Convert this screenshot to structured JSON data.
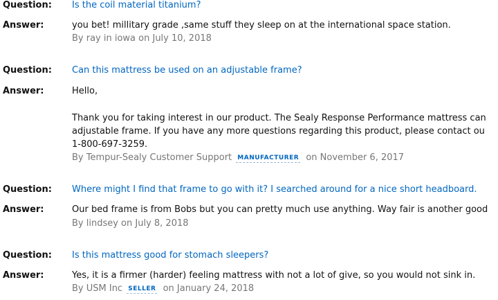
{
  "labels": {
    "question": "Question:",
    "answer": "Answer:"
  },
  "qa": [
    {
      "question": "Is the coil material titanium?",
      "answer_lines": [
        "you bet! millitary grade ,same stuff they sleep on at the international space station."
      ],
      "byline_prefix": "By ray in iowa on July 10, 2018"
    },
    {
      "question": "Can this mattress be used on an adjustable frame?",
      "answer_lines": [
        "Hello,",
        "",
        "Thank you for taking interest in our product. The Sealy Response Performance mattress can",
        "adjustable frame. If you have any more questions regarding this product, please contact ou",
        "1-800-697-3259."
      ],
      "byline_author": "By Tempur-Sealy Customer Support",
      "badge": "MANUFACTURER",
      "byline_date": "on November 6, 2017"
    },
    {
      "question": "Where might I find that frame to go with it? I searched around for a nice short headboard.",
      "answer_lines": [
        "Our bed frame is from Bobs but you can pretty much use anything. Way fair is another good"
      ],
      "byline_prefix": "By lindsey on July 8, 2018"
    },
    {
      "question": "Is this mattress good for stomach sleepers?",
      "answer_lines": [
        "Yes, it is a firmer (harder) feeling mattress with not a lot of give, so you would not sink in."
      ],
      "byline_author": "By USM Inc",
      "badge": "SELLER",
      "byline_date": "on January 24, 2018"
    }
  ],
  "colors": {
    "link": "#0066c0",
    "text": "#111111",
    "muted": "#767676"
  }
}
